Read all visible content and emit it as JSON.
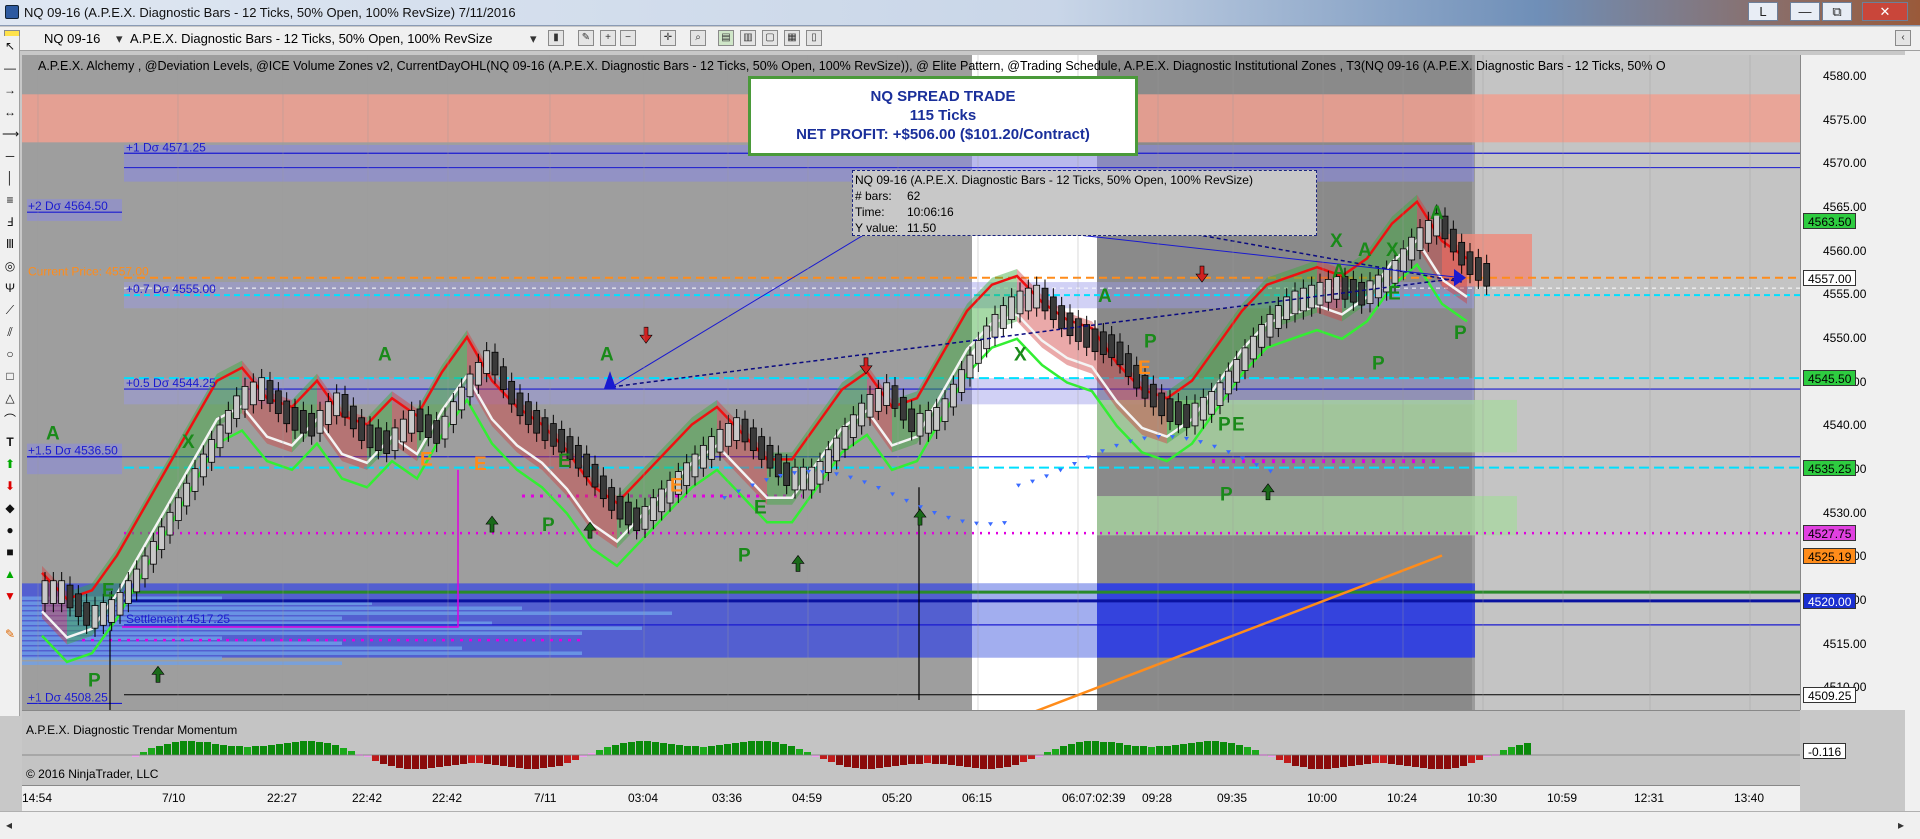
{
  "window": {
    "title": "NQ 09-16 (A.P.E.X. Diagnostic Bars - 12 Ticks, 50% Open, 100% RevSize)  7/11/2016",
    "buttons": [
      "L",
      "—",
      "⧉",
      "✕"
    ]
  },
  "toolbar": {
    "instrument": "NQ 09-16",
    "series": "A.P.E.X. Diagnostic Bars - 12 Ticks, 50% Open, 100% RevSize"
  },
  "indicators_line": "A.P.E.X. Alchemy , @Deviation Levels, @ICE Volume Zones v2, CurrentDayOHL(NQ 09-16 (A.P.E.X. Diagnostic Bars - 12 Ticks, 50% Open, 100% RevSize)), @ Elite Pattern, @Trading Schedule, A.P.E.X. Diagnostic Institutional Zones , T3(NQ 09-16 (A.P.E.X. Diagnostic Bars - 12 Ticks, 50% O",
  "trade_box": {
    "line1": "NQ SPREAD TRADE",
    "line2": "115 Ticks",
    "line3": "NET PROFIT: +$506.00 ($101.20/Contract)"
  },
  "data_box": {
    "title": "NQ 09-16 (A.P.E.X. Diagnostic Bars - 12 Ticks, 50% Open, 100% RevSize)",
    "rows": [
      {
        "k": "# bars:",
        "v": "62"
      },
      {
        "k": "Time:",
        "v": "10:06:16"
      },
      {
        "k": "Y value:",
        "v": "11.50"
      }
    ]
  },
  "level_labels": [
    {
      "text": "+1 Dσ 4571.25",
      "price": 4571.25
    },
    {
      "text": "+2 Dσ 4564.50",
      "price": 4564.5
    },
    {
      "text": "Current Price: 4557.00",
      "price": 4557.0
    },
    {
      "text": "+0.7 Dσ 4555.00",
      "price": 4555.0
    },
    {
      "text": "+0.5 Dσ 4544.25",
      "price": 4544.25
    },
    {
      "text": "+1.5 Dσ 4536.50",
      "price": 4536.5
    },
    {
      "text": "Settlement 4517.25",
      "price": 4517.25
    },
    {
      "text": "+1 Dσ 4508.25",
      "price": 4508.25
    }
  ],
  "pattern_letters": [
    "A",
    "X",
    "E",
    "P",
    "A",
    "E",
    "E",
    "P",
    "A",
    "E",
    "E",
    "P",
    "X",
    "A",
    "E",
    "E",
    "P",
    "A",
    "X",
    "E",
    "P",
    "A",
    "P",
    "A",
    "X",
    "P",
    "P",
    "E"
  ],
  "y_axis": {
    "ticks": [
      "4580.00",
      "4575.00",
      "4570.00",
      "4565.00",
      "4560.00",
      "4555.00",
      "4550.00",
      "4545.00",
      "4540.00",
      "4535.00",
      "4530.00",
      "4525.00",
      "4520.00",
      "4515.00",
      "4510.00"
    ],
    "badges": [
      {
        "text": "4563.50",
        "bg": "#2ecc40",
        "fg": "#000000"
      },
      {
        "text": "4557.00",
        "bg": "#ffffff",
        "fg": "#000000"
      },
      {
        "text": "4545.50",
        "bg": "#2ecc40",
        "fg": "#000000"
      },
      {
        "text": "4535.25",
        "bg": "#2ecc40",
        "fg": "#000000"
      },
      {
        "text": "4527.75",
        "bg": "#e040e0",
        "fg": "#000000"
      },
      {
        "text": "4525.19",
        "bg": "#ff8c1a",
        "fg": "#000000"
      },
      {
        "text": "4520.00",
        "bg": "#1a2fd0",
        "fg": "#ffffff"
      },
      {
        "text": "4509.25",
        "bg": "#ffffff",
        "fg": "#000000"
      }
    ],
    "indicator_badge": "-0.116"
  },
  "x_axis": {
    "ticks": [
      "14:54",
      "7/10",
      "22:27",
      "22:42",
      "22:42",
      "7/11",
      "03:04",
      "03:36",
      "04:59",
      "05:20",
      "06:15",
      "06:07:02:39",
      "09:28",
      "09:35",
      "10:00",
      "10:24",
      "10:30",
      "10:59",
      "12:31",
      "13:40"
    ]
  },
  "indicator_panel": {
    "title": "A.P.E.X. Diagnostic Trendar Momentum",
    "copyright": "© 2016 NinjaTrader, LLC"
  },
  "colors": {
    "background": "#c4c4c4",
    "bull": "#00c800",
    "bear": "#e00000",
    "cyan_level": "#00e0ff",
    "magenta_level": "#e000e0",
    "blue_zone": "#2a3fd0",
    "orange_trend": "#ff8c1a"
  }
}
